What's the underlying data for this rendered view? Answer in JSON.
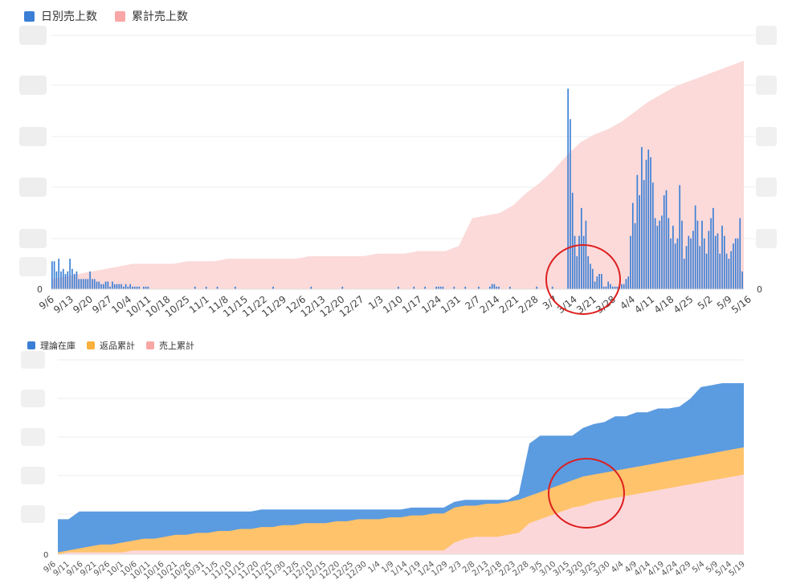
{
  "chart_data": [
    {
      "type": "bar",
      "legend": [
        "日別売上数",
        "累計売上数"
      ],
      "series": [
        {
          "name": "日別売上数",
          "kind": "bar",
          "color": "#3a7fd5"
        },
        {
          "name": "累計売上数",
          "kind": "area",
          "color": "#f9a6a6"
        }
      ],
      "x_tick_labels": [
        "9/6",
        "9/13",
        "9/20",
        "9/27",
        "10/4",
        "10/11",
        "10/18",
        "10/25",
        "11/1",
        "11/8",
        "11/15",
        "11/22",
        "11/29",
        "12/6",
        "12/13",
        "12/20",
        "12/27",
        "1/3",
        "1/10",
        "1/17",
        "1/24",
        "1/31",
        "2/7",
        "2/14",
        "2/21",
        "2/28",
        "3/7",
        "3/14",
        "3/21",
        "3/28",
        "4/4",
        "4/11",
        "4/18",
        "4/25",
        "5/2",
        "5/9",
        "5/16"
      ],
      "y_left_tick_labels": [
        "0"
      ],
      "y_right_tick_labels": [
        "0"
      ],
      "daily_bar_height_fraction": [
        0.11,
        0.11,
        0.07,
        0.12,
        0.07,
        0.08,
        0.06,
        0.07,
        0.12,
        0.08,
        0.06,
        0.07,
        0.04,
        0.04,
        0.04,
        0.04,
        0.04,
        0.07,
        0.04,
        0.04,
        0.03,
        0.03,
        0.02,
        0.02,
        0.03,
        0.03,
        0.01,
        0.03,
        0.02,
        0.02,
        0.02,
        0.02,
        0.01,
        0.02,
        0.01,
        0.02,
        0.01,
        0.01,
        0.01,
        0.01,
        0,
        0.01,
        0.01,
        0.01,
        0,
        0,
        0,
        0,
        0,
        0,
        0,
        0,
        0,
        0,
        0,
        0,
        0,
        0,
        0,
        0,
        0,
        0,
        0,
        0,
        0.01,
        0,
        0,
        0,
        0,
        0.01,
        0,
        0,
        0,
        0,
        0.01,
        0,
        0,
        0,
        0,
        0,
        0,
        0,
        0.01,
        0,
        0,
        0,
        0,
        0,
        0,
        0,
        0,
        0,
        0,
        0,
        0,
        0,
        0,
        0,
        0,
        0.01,
        0,
        0,
        0,
        0,
        0,
        0,
        0,
        0,
        0,
        0,
        0,
        0,
        0,
        0,
        0,
        0,
        0.01,
        0,
        0,
        0,
        0,
        0,
        0,
        0,
        0,
        0,
        0,
        0,
        0,
        0,
        0.01,
        0,
        0,
        0,
        0,
        0,
        0,
        0,
        0,
        0,
        0,
        0,
        0,
        0,
        0,
        0,
        0,
        0,
        0,
        0,
        0,
        0,
        0,
        0,
        0,
        0.01,
        0,
        0,
        0,
        0,
        0,
        0,
        0.01,
        0,
        0,
        0,
        0,
        0.01,
        0,
        0,
        0,
        0,
        0.01,
        0.01,
        0.01,
        0.01,
        0,
        0,
        0,
        0,
        0.01,
        0,
        0,
        0,
        0,
        0.01,
        0,
        0,
        0,
        0,
        0,
        0.01,
        0,
        0,
        0,
        0,
        0.01,
        0.02,
        0.02,
        0.01,
        0.01,
        0,
        0,
        0,
        0,
        0.01,
        0,
        0,
        0,
        0,
        0,
        0,
        0,
        0,
        0,
        0,
        0,
        0.01,
        0,
        0,
        0,
        0,
        0,
        0,
        0.01,
        0,
        0,
        0,
        0,
        0,
        0,
        0.79,
        0.67,
        0.38,
        0.21,
        0.13,
        0.21,
        0.32,
        0.21,
        0.27,
        0.13,
        0.1,
        0.08,
        0.03,
        0.05,
        0.06,
        0.06,
        0.01,
        0.01,
        0.03,
        0.02,
        0.01,
        0.01,
        0.01,
        0.01,
        0.02,
        0.02,
        0.04,
        0.05,
        0.21,
        0.34,
        0.26,
        0.45,
        0.37,
        0.56,
        0.43,
        0.51,
        0.55,
        0.52,
        0.42,
        0.28,
        0.25,
        0.27,
        0.29,
        0.37,
        0.39,
        0.28,
        0.2,
        0.25,
        0.18,
        0.2,
        0.41,
        0.27,
        0.12,
        0.17,
        0.21,
        0.2,
        0.23,
        0.33,
        0.27,
        0.17,
        0.27,
        0.2,
        0.14,
        0.23,
        0.28,
        0.32,
        0.21,
        0.22,
        0.14,
        0.25,
        0.21,
        0.14,
        0.12,
        0.15,
        0.18,
        0.2,
        0.2,
        0.28,
        0.07
      ],
      "cumulative_area_fraction": [
        0.04,
        0.05,
        0.06,
        0.07,
        0.08,
        0.09,
        0.1,
        0.1,
        0.1,
        0.1,
        0.11,
        0.11,
        0.11,
        0.12,
        0.12,
        0.12,
        0.12,
        0.12,
        0.12,
        0.13,
        0.13,
        0.13,
        0.13,
        0.13,
        0.14,
        0.14,
        0.14,
        0.15,
        0.15,
        0.15,
        0.17,
        0.28,
        0.29,
        0.3,
        0.33,
        0.38,
        0.42,
        0.47,
        0.53,
        0.58,
        0.61,
        0.63,
        0.66,
        0.7,
        0.74,
        0.77,
        0.8,
        0.82,
        0.84,
        0.86,
        0.88,
        0.9
      ]
    },
    {
      "type": "area",
      "legend": [
        "理論在庫",
        "返品累計",
        "売上累計"
      ],
      "series": [
        {
          "name": "理論在庫",
          "color": "#4a90dc"
        },
        {
          "name": "返品累計",
          "color": "#ffc36b"
        },
        {
          "name": "売上累計",
          "color": "#fcd7d9"
        }
      ],
      "x_tick_labels": [
        "9/6",
        "9/11",
        "9/16",
        "9/21",
        "9/26",
        "10/1",
        "10/6",
        "10/11",
        "10/16",
        "10/21",
        "10/26",
        "10/31",
        "11/5",
        "11/10",
        "11/15",
        "11/20",
        "11/25",
        "11/30",
        "12/5",
        "12/10",
        "12/15",
        "12/20",
        "12/25",
        "12/30",
        "1/4",
        "1/9",
        "1/14",
        "1/19",
        "1/24",
        "1/29",
        "2/3",
        "2/8",
        "2/13",
        "2/18",
        "2/23",
        "2/28",
        "3/5",
        "3/10",
        "3/15",
        "3/20",
        "3/25",
        "3/30",
        "4/4",
        "4/9",
        "4/14",
        "4/19",
        "4/24",
        "4/29",
        "5/4",
        "5/9",
        "5/14",
        "5/19"
      ],
      "y_tick_labels": [
        "0"
      ],
      "inventory_top_fraction": [
        0.18,
        0.18,
        0.22,
        0.22,
        0.22,
        0.22,
        0.22,
        0.22,
        0.22,
        0.22,
        0.22,
        0.22,
        0.22,
        0.22,
        0.22,
        0.22,
        0.22,
        0.22,
        0.22,
        0.23,
        0.23,
        0.23,
        0.23,
        0.23,
        0.23,
        0.23,
        0.23,
        0.23,
        0.23,
        0.23,
        0.23,
        0.23,
        0.23,
        0.24,
        0.24,
        0.24,
        0.24,
        0.27,
        0.28,
        0.28,
        0.28,
        0.28,
        0.28,
        0.31,
        0.57,
        0.61,
        0.61,
        0.61,
        0.61,
        0.65,
        0.67,
        0.68,
        0.71,
        0.71,
        0.73,
        0.73,
        0.75,
        0.75,
        0.76,
        0.8,
        0.86,
        0.87,
        0.88,
        0.88,
        0.88
      ],
      "returns_top_fraction": [
        0.01,
        0.02,
        0.03,
        0.04,
        0.05,
        0.05,
        0.06,
        0.07,
        0.08,
        0.08,
        0.09,
        0.1,
        0.1,
        0.11,
        0.11,
        0.12,
        0.12,
        0.13,
        0.13,
        0.14,
        0.14,
        0.15,
        0.15,
        0.16,
        0.16,
        0.16,
        0.17,
        0.17,
        0.18,
        0.18,
        0.18,
        0.19,
        0.19,
        0.2,
        0.2,
        0.21,
        0.21,
        0.24,
        0.25,
        0.25,
        0.26,
        0.26,
        0.27,
        0.28,
        0.3,
        0.32,
        0.34,
        0.36,
        0.38,
        0.4,
        0.41,
        0.42,
        0.43,
        0.44,
        0.45,
        0.46,
        0.47,
        0.48,
        0.49,
        0.5,
        0.51,
        0.52,
        0.53,
        0.54,
        0.55
      ],
      "sales_top_fraction": [
        0,
        0.01,
        0.01,
        0.01,
        0.01,
        0.01,
        0.01,
        0.02,
        0.02,
        0.02,
        0.02,
        0.02,
        0.02,
        0.02,
        0.02,
        0.02,
        0.02,
        0.02,
        0.02,
        0.02,
        0.02,
        0.02,
        0.02,
        0.02,
        0.02,
        0.02,
        0.02,
        0.02,
        0.02,
        0.02,
        0.02,
        0.02,
        0.02,
        0.02,
        0.02,
        0.02,
        0.02,
        0.06,
        0.08,
        0.09,
        0.09,
        0.09,
        0.1,
        0.11,
        0.16,
        0.18,
        0.2,
        0.22,
        0.24,
        0.25,
        0.27,
        0.28,
        0.29,
        0.3,
        0.31,
        0.32,
        0.33,
        0.34,
        0.35,
        0.36,
        0.37,
        0.38,
        0.39,
        0.4,
        0.41
      ]
    }
  ],
  "annotations": [
    {
      "shape": "circle",
      "color": "#dd1f1f",
      "chart": 0,
      "note": "red circle around 3/14–3/28 low-sales period"
    },
    {
      "shape": "circle",
      "color": "#dd1f1f",
      "chart": 1,
      "note": "red circle around 3/15–3/30 flat inventory period"
    }
  ]
}
